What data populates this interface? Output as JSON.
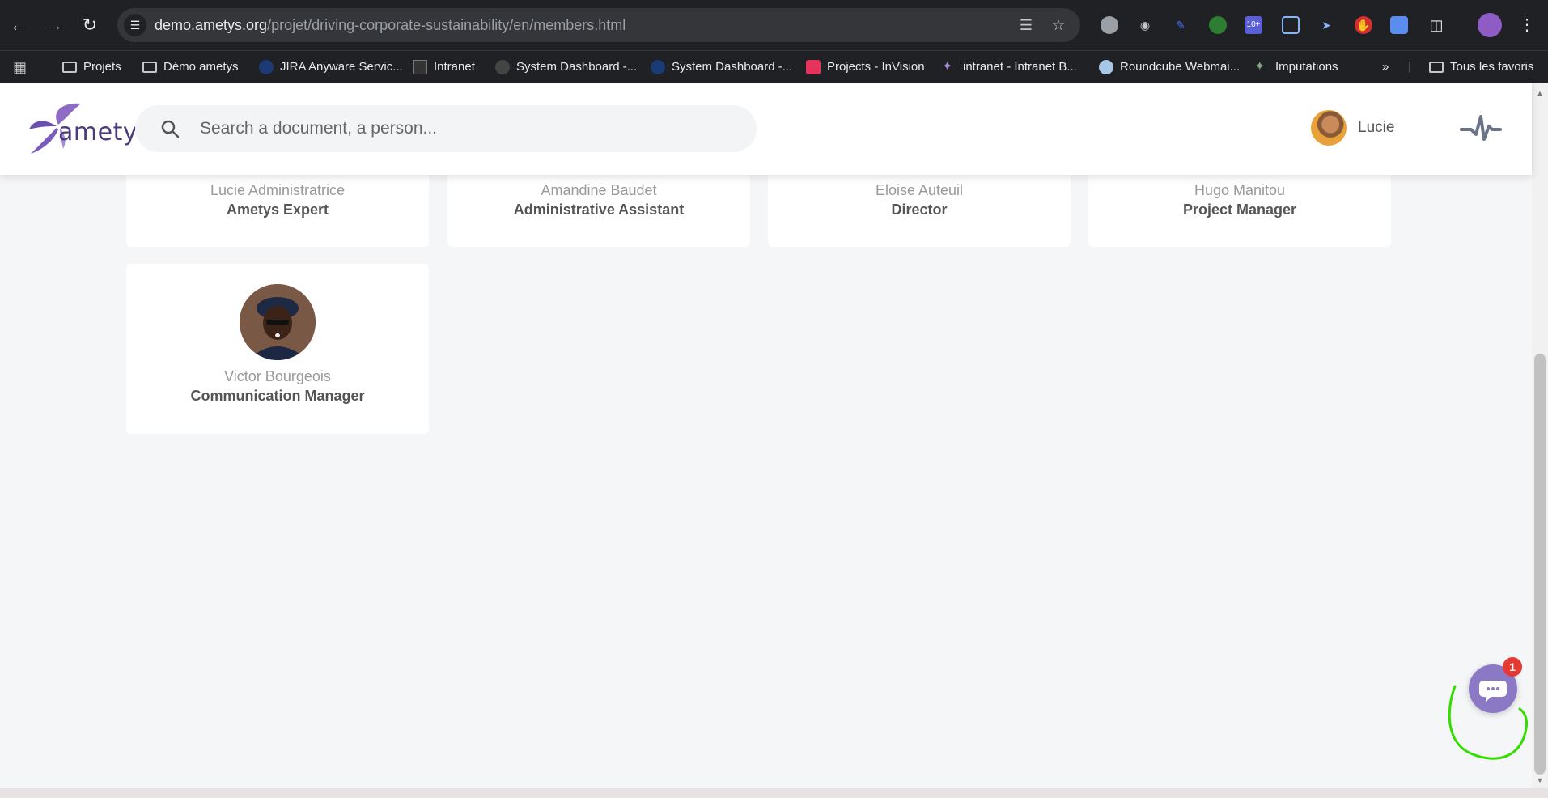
{
  "browser": {
    "url_domain": "demo.ametys.org",
    "url_path": "/projet/driving-corporate-sustainability/en/members.html",
    "bookmarks": [
      {
        "label": "Projets",
        "icon": "folder-icon"
      },
      {
        "label": "Démo ametys",
        "icon": "folder-icon"
      },
      {
        "label": "JIRA Anyware Servic...",
        "icon": "jira-icon"
      },
      {
        "label": "Intranet",
        "icon": "intranet-icon"
      },
      {
        "label": "System Dashboard -...",
        "icon": "dashboard-icon"
      },
      {
        "label": "System Dashboard -...",
        "icon": "jira-icon"
      },
      {
        "label": "Projects - InVision",
        "icon": "invision-icon"
      },
      {
        "label": "intranet - Intranet B...",
        "icon": "ametys-icon"
      },
      {
        "label": "Roundcube Webmai...",
        "icon": "roundcube-icon"
      },
      {
        "label": "Imputations",
        "icon": "ametys-icon"
      }
    ],
    "more_bookmarks": "»",
    "all_bookmarks": "Tous les favoris",
    "extension_badge": "10+"
  },
  "header": {
    "logo_text": "ametys",
    "search_placeholder": "Search a document, a person...",
    "user_name": "Lucie"
  },
  "members": [
    {
      "name": "Lucie Administratrice",
      "role": "Ametys Expert"
    },
    {
      "name": "Amandine Baudet",
      "role": "Administrative Assistant"
    },
    {
      "name": "Eloise Auteuil",
      "role": "Director"
    },
    {
      "name": "Hugo Manitou",
      "role": "Project Manager"
    },
    {
      "name": "Victor Bourgeois",
      "role": "Communication Manager"
    }
  ],
  "chat": {
    "badge_count": "1"
  },
  "colors": {
    "brand": "#8c79c6",
    "badge": "#e53935",
    "annotation": "#33dd00"
  }
}
